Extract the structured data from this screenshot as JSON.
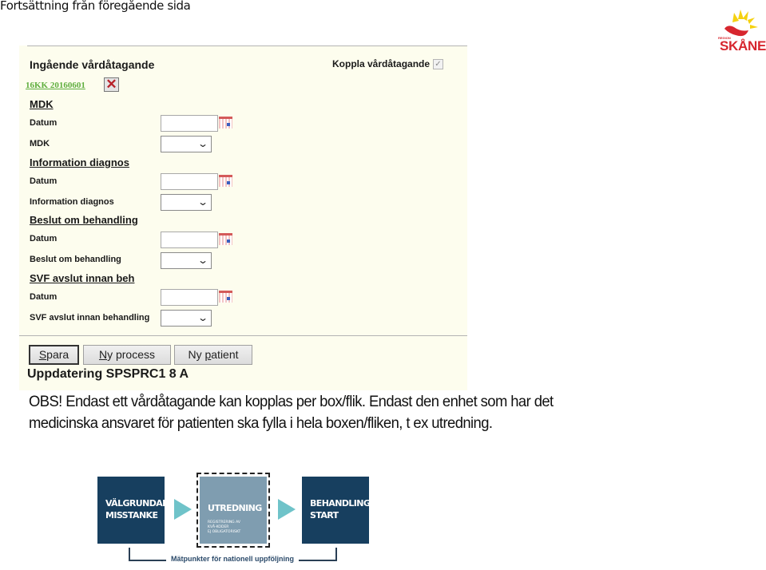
{
  "page": {
    "continued_label": "Fortsättning från föregående sida"
  },
  "logo": {
    "name": "region-skane-logo",
    "small_text": "REGION",
    "text": "SKÅNE"
  },
  "form": {
    "header": "Ingående vårdåtagande",
    "koppla_label": "Koppla vårdåtagande",
    "koppla_checked": true,
    "link_text": "16KK 20160601",
    "delete_icon": "close-icon",
    "sections": [
      {
        "title": "MDK",
        "date_label": "Datum",
        "date_value": "",
        "select_label": "MDK",
        "select_value": ""
      },
      {
        "title": "Information diagnos",
        "date_label": "Datum",
        "date_value": "",
        "select_label": "Information diagnos",
        "select_value": ""
      },
      {
        "title": "Beslut om behandling",
        "date_label": "Datum",
        "date_value": "",
        "select_label": "Beslut om behandling",
        "select_value": ""
      },
      {
        "title": "SVF avslut innan beh",
        "date_label": "Datum",
        "date_value": "",
        "select_label": "SVF avslut innan behandling",
        "select_value": ""
      }
    ],
    "buttons": {
      "save": {
        "accel": "S",
        "rest": "para"
      },
      "new_process": {
        "accel": "N",
        "rest": "y process"
      },
      "new_patient": {
        "pre": "Ny ",
        "accel": "p",
        "rest": "atient"
      }
    },
    "update_title": "Uppdatering SPSPRC1 8 A"
  },
  "note": {
    "text": "OBS! Endast ett vårdåtagande kan kopplas per box/flik. Endast den enhet som har det medicinska ansvaret för patienten ska fylla i hela boxen/fliken, t ex utredning."
  },
  "diagram": {
    "steps": [
      {
        "line1": "VÄLGRUNDAD",
        "line2": "MISSTANKE"
      },
      {
        "line1": "UTREDNING",
        "sub1": "REGISTRERING AV",
        "sub2": "KVÅ-KODER",
        "sub3": "EJ OBLIGATORISKT"
      },
      {
        "line1": "BEHANDLINGS-",
        "line2": "START"
      }
    ],
    "measure_label": "Mätpunkter för nationell uppföljning",
    "colors": {
      "dark": "#173f5f",
      "mid": "#7f9db0",
      "arrow": "#6fc3c9"
    }
  }
}
